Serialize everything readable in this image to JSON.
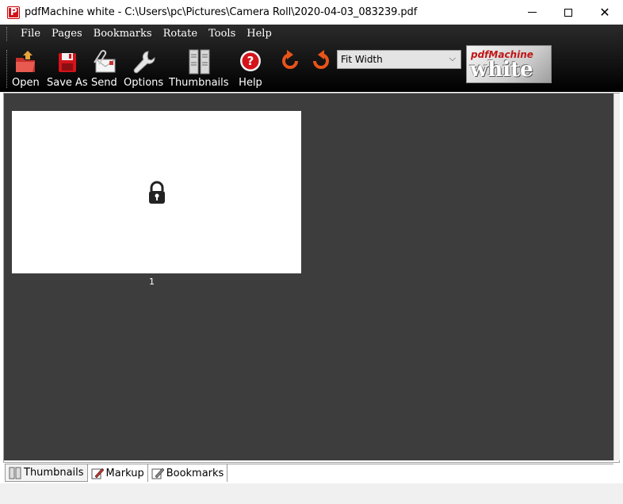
{
  "window": {
    "title": "pdfMachine white - C:\\Users\\pc\\Pictures\\Camera Roll\\2020-04-03_083239.pdf",
    "app_icon_letter": "P",
    "close_glyph": "✕"
  },
  "menu": [
    "File",
    "Pages",
    "Bookmarks",
    "Rotate",
    "Tools",
    "Help"
  ],
  "toolbar": {
    "open": "Open",
    "save_as": "Save As",
    "send": "Send",
    "options": "Options",
    "thumbnails": "Thumbnails",
    "help": "Help",
    "zoom_value": "Fit Width",
    "zoom_arrow": "⌵"
  },
  "logo": {
    "line1": "pdfMachine",
    "line2": "white"
  },
  "pages": [
    {
      "number": "1",
      "icon": "lock-icon"
    }
  ],
  "tabs": {
    "thumbnails": "Thumbnails",
    "markup": "Markup",
    "bookmarks": "Bookmarks"
  },
  "colors": {
    "accent_red": "#d4141b",
    "viewer_bg": "#3d3d3d",
    "toolbar_bg": "#000000"
  }
}
